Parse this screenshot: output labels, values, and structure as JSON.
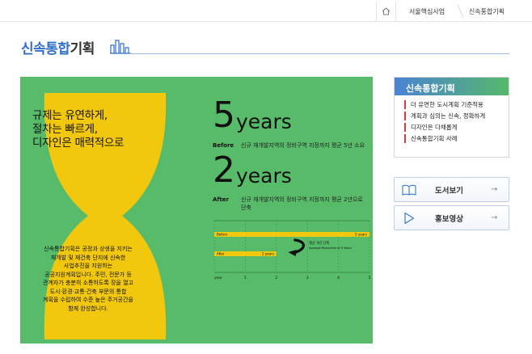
{
  "breadcrumb": {
    "home_icon": "home-icon",
    "items": [
      "서울핵심사업",
      "신속통합기획"
    ]
  },
  "page": {
    "title_blue": "신속통합",
    "title_dark": "기획"
  },
  "panel": {
    "slogan": [
      "규제는 유연하게,",
      "절차는 빠르게,",
      "디자인은 매력적으로"
    ],
    "description": [
      "신속통합기획은 공정과 상생을 지키는",
      "재개발 및 재건축 단지에 신속한",
      "사업추진을 지원하는",
      "공공지원계획입니다. 주민, 전문가 등",
      "관계자가 충분히 소통하도록 장을 열고",
      "도시·환경·교통·건축 부문의 통합",
      "계획을 수립하여 수준 높은 주거공간을",
      "함께 완성합니다."
    ],
    "before": {
      "number": "5",
      "unit": "years",
      "label": "Before",
      "text": "신규 재개발지역의 정비구역 지정까지 평균 5년 소요"
    },
    "after": {
      "number": "2",
      "unit": "years",
      "label": "After",
      "text_line1": "신규 재개발지역의 정비구역 지정까지 평균 2년으로",
      "text_line2": "단축"
    },
    "colors": {
      "panel_green": "#57bb6a",
      "hourglass_yellow": "#f2c80f",
      "accent_blue": "#2f6fc7"
    }
  },
  "chart_data": {
    "type": "bar",
    "orientation": "horizontal",
    "categories": [
      "Before",
      "After"
    ],
    "values": [
      5,
      2
    ],
    "bar_labels": [
      "5 years",
      "2 years"
    ],
    "x_ticks": [
      "year",
      "1",
      "2",
      "3",
      "4",
      "5"
    ],
    "xlim": [
      0,
      5
    ],
    "grid": true,
    "annotation_line1": "평균 3년 단축",
    "annotation_line2": "Average Reduction of 3 Years"
  },
  "sidebar": {
    "header": "신속통합기획",
    "items": [
      "더 유연한 도시계획 기준적용",
      "계획과 심의는 신속, 정확하게",
      "디자인은 다채롭게",
      "신속통합기획 사례"
    ],
    "buttons": [
      {
        "label": "도서보기",
        "icon": "book-icon",
        "arrow": "→"
      },
      {
        "label": "홍보영상",
        "icon": "play-icon",
        "arrow": "→"
      }
    ]
  }
}
